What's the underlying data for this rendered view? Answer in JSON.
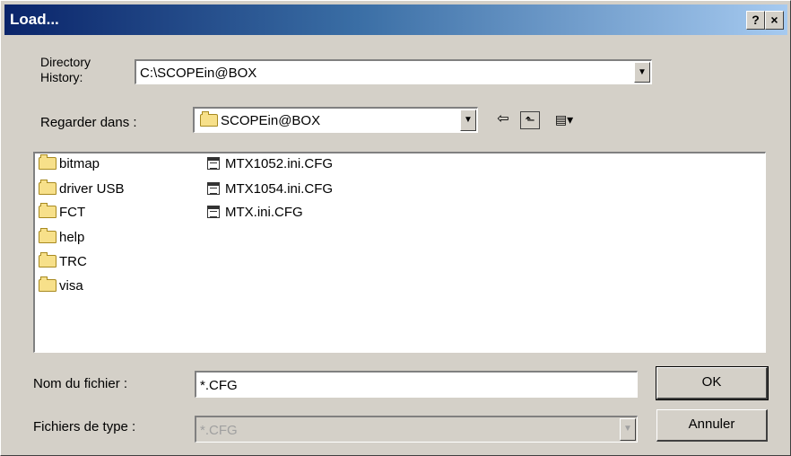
{
  "window": {
    "title": "Load...",
    "help_label": "?",
    "close_label": "×"
  },
  "history": {
    "label_line1": "Directory",
    "label_line2": "History:",
    "value": "C:\\SCOPEin@BOX"
  },
  "look_in": {
    "label": "Regarder dans :",
    "value": "SCOPEin@BOX",
    "back_glyph": "⇦",
    "up_glyph": "⬑",
    "view_glyph": "▤▾"
  },
  "files": {
    "folders": [
      "bitmap",
      "driver USB",
      "FCT",
      "help",
      "TRC",
      "visa"
    ],
    "files": [
      "MTX1052.ini.CFG",
      "MTX1054.ini.CFG",
      "MTX.ini.CFG"
    ]
  },
  "filename": {
    "label": "Nom du fichier :",
    "value": "*.CFG"
  },
  "filetype": {
    "label": "Fichiers de type :",
    "value": "*.CFG"
  },
  "buttons": {
    "ok": "OK",
    "cancel": "Annuler"
  }
}
